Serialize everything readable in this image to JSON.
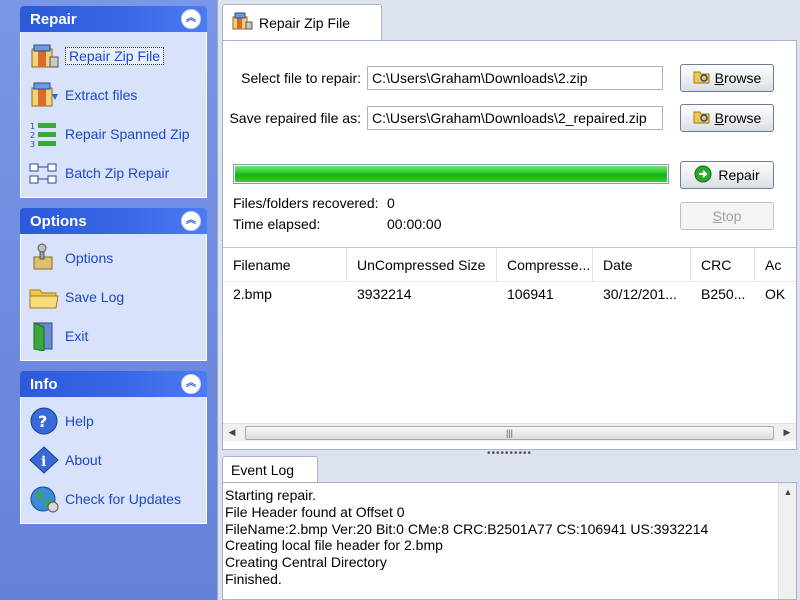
{
  "sidebar": {
    "groups": [
      {
        "title": "Repair",
        "items": [
          {
            "label": "Repair Zip File",
            "icon": "zip-repair-icon",
            "selected": true
          },
          {
            "label": "Extract files",
            "icon": "extract-icon"
          },
          {
            "label": "Repair Spanned Zip",
            "icon": "numbered-list-icon"
          },
          {
            "label": "Batch Zip Repair",
            "icon": "batch-icon"
          }
        ]
      },
      {
        "title": "Options",
        "items": [
          {
            "label": "Options",
            "icon": "options-icon"
          },
          {
            "label": "Save Log",
            "icon": "folder-icon"
          },
          {
            "label": "Exit",
            "icon": "exit-door-icon"
          }
        ]
      },
      {
        "title": "Info",
        "items": [
          {
            "label": "Help",
            "icon": "help-icon"
          },
          {
            "label": "About",
            "icon": "info-icon"
          },
          {
            "label": "Check for Updates",
            "icon": "globe-icon"
          }
        ]
      }
    ]
  },
  "repair_tab": {
    "label": "Repair Zip File",
    "select_label": "Select file to repair:",
    "select_value": "C:\\Users\\Graham\\Downloads\\2.zip",
    "save_label": "Save repaired file as:",
    "save_value": "C:\\Users\\Graham\\Downloads\\2_repaired.zip",
    "browse_label": "Browse",
    "browse_mnemonic": "B",
    "browse_rest": "rowse",
    "repair_label": "Repair",
    "stop_label": "Stop",
    "stop_mnemonic": "S",
    "stop_rest": "top",
    "progress": 1.0,
    "recovered_label": "Files/folders recovered:",
    "recovered_value": "0",
    "elapsed_label": "Time elapsed:",
    "elapsed_value": "00:00:00"
  },
  "table": {
    "columns": [
      "Filename",
      "UnCompressed Size",
      "Compresse...",
      "Date",
      "CRC",
      "Ac"
    ],
    "rows": [
      [
        "2.bmp",
        "3932214",
        "106941",
        "30/12/201...",
        "B250...",
        "OK"
      ]
    ]
  },
  "log_tab": {
    "label": "Event Log",
    "lines": [
      "Starting repair.",
      "File Header found at Offset 0",
      "FileName:2.bmp Ver:20 Bit:0 CMe:8 CRC:B2501A77 CS:106941 US:3932214",
      "Creating local file header for 2.bmp",
      "Creating Central Directory",
      "Finished."
    ]
  },
  "colors": {
    "sidebar_bg": "#7a96e6",
    "group_header": "#2b5ad8",
    "link_text": "#1c48c8",
    "progress_green": "#26c626"
  }
}
